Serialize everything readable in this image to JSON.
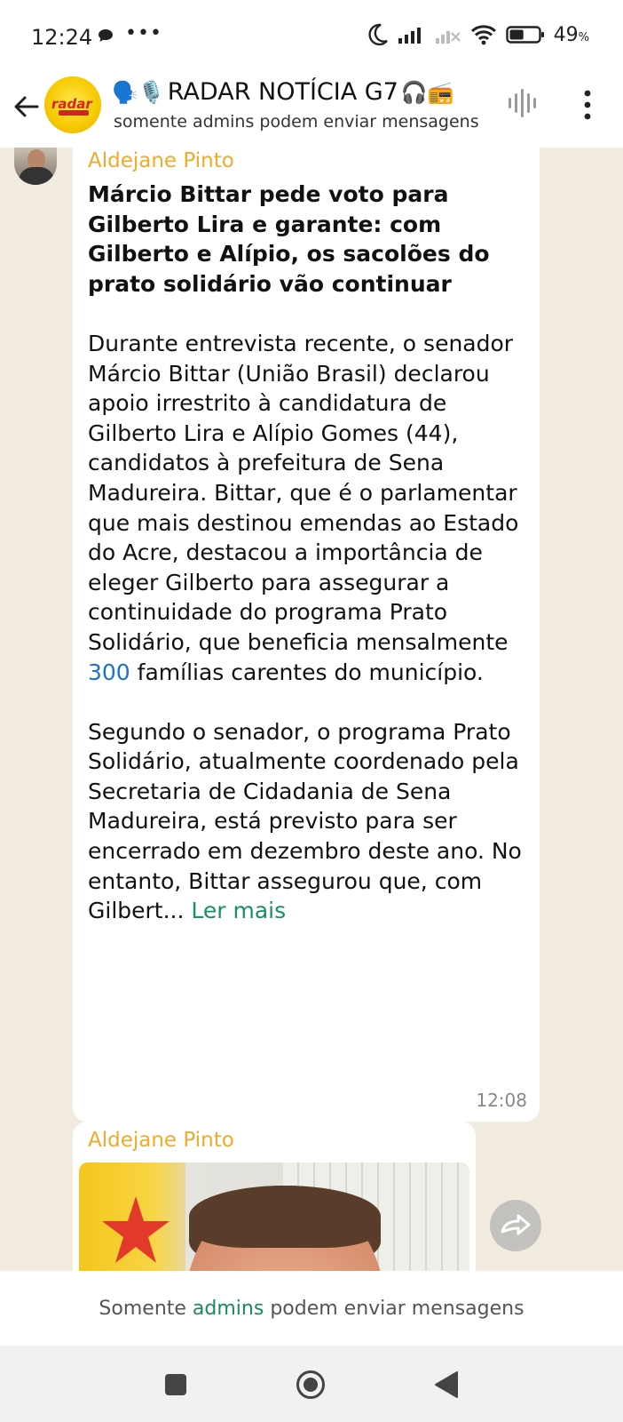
{
  "status_bar": {
    "time": "12:24",
    "battery_text": "49",
    "battery_unit": "%",
    "battery_level": 0.49,
    "icons": [
      "message-icon",
      "more-dots-icon",
      "moon-icon",
      "signal-icon",
      "signal-off-icon",
      "wifi-icon",
      "battery-icon"
    ]
  },
  "header": {
    "title": "RADAR NOTÍCIA G7",
    "subtitle": "somente admins podem enviar mensagens",
    "title_emojis_left": "🗣️🎙️",
    "title_emojis_right": "🎧📻",
    "avatar_text": "radar"
  },
  "message1": {
    "sender": "Aldejane Pinto",
    "headline": "Márcio Bittar pede voto para Gilberto Lira e garante: com Gilberto e Alípio, os sacolões do prato solidário vão continuar",
    "para1_before": "Durante entrevista recente, o senador Márcio Bittar (União Brasil) declarou apoio irrestrito à candidatura de Gilberto Lira e Alípio Gomes (44), candidatos à prefeitura de Sena Madureira. Bittar, que é o parlamentar que mais destinou emendas ao Estado do Acre, destacou a importância de eleger Gilberto para assegurar a continuidade do programa Prato Solidário, que beneficia mensalmente ",
    "para1_number": "300",
    "para1_after": " famílias carentes do município.",
    "para2": "Segundo o senador, o programa Prato Solidário, atualmente coordenado pela Secretaria de Cidadania de Sena Madureira, está previsto para ser encerrado em dezembro deste ano. No entanto, Bittar assegurou que, com Gilbert...",
    "read_more": "Ler mais",
    "time": "12:08"
  },
  "message2": {
    "sender": "Aldejane Pinto"
  },
  "footer": {
    "notice_before": "Somente ",
    "notice_link": "admins",
    "notice_after": " podem enviar mensagens"
  },
  "colors": {
    "sender": "#f0ab2a",
    "link_number": "#1b72c9",
    "read_more": "#19915f",
    "admins": "#1b8a5a",
    "chat_bg": "#f2ebe0"
  }
}
